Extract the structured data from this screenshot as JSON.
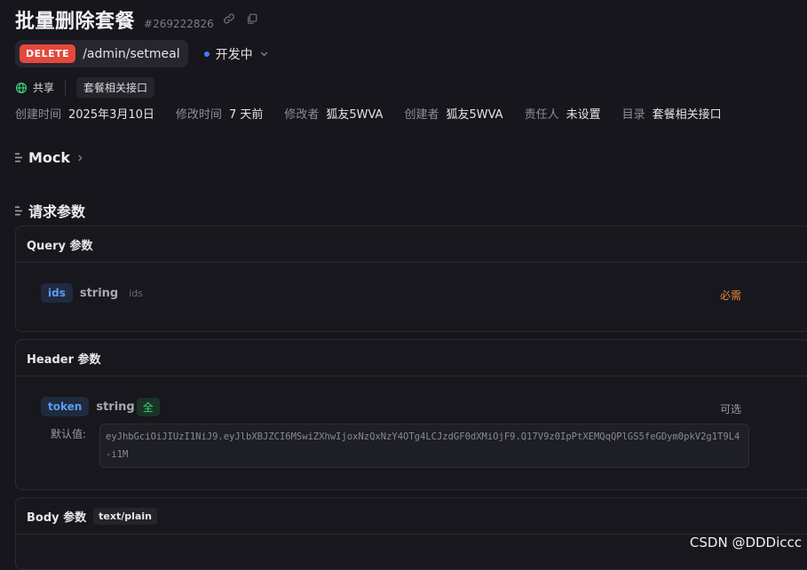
{
  "header": {
    "title": "批量删除套餐",
    "api_id": "#269222826",
    "icons": [
      "link-icon",
      "copy-icon"
    ]
  },
  "endpoint": {
    "method": "DELETE",
    "path": "/admin/setmeal",
    "status": "开发中"
  },
  "share": {
    "label": "共享",
    "folder_tag": "套餐相关接口"
  },
  "meta": [
    {
      "label": "创建时间",
      "value": "2025年3月10日"
    },
    {
      "label": "修改时间",
      "value": "7 天前"
    },
    {
      "label": "修改者",
      "value": "狐友5WVA"
    },
    {
      "label": "创建者",
      "value": "狐友5WVA"
    },
    {
      "label": "责任人",
      "value": "未设置"
    },
    {
      "label": "目录",
      "value": "套餐相关接口"
    }
  ],
  "sections": {
    "mock": "Mock",
    "request_params": "请求参数"
  },
  "query": {
    "title": "Query 参数",
    "params": [
      {
        "name": "ids",
        "type": "string",
        "desc": "ids",
        "requirement": "必需"
      }
    ]
  },
  "header_params": {
    "title": "Header 参数",
    "params": [
      {
        "name": "token",
        "type": "string",
        "badge": "全",
        "requirement": "可选",
        "default_label": "默认值:",
        "default_value": "eyJhbGciOiJIUzI1NiJ9.eyJlbXBJZCI6MSwiZXhwIjoxNzQxNzY4OTg4LCJzdGF0dXMiOjF9.Q17V9z0IpPtXEMQqQPlGS5feGDym0pkV2g1T9L4-i1M"
      }
    ]
  },
  "body": {
    "title": "Body 参数",
    "content_type": "text/plain"
  },
  "watermark": "CSDN @DDDiccc",
  "colors": {
    "background": "#16161c",
    "delete_method": "#e5483c",
    "required": "#e8873a",
    "param_name": "#5b9bf0",
    "status_dot": "#3b82f6"
  }
}
